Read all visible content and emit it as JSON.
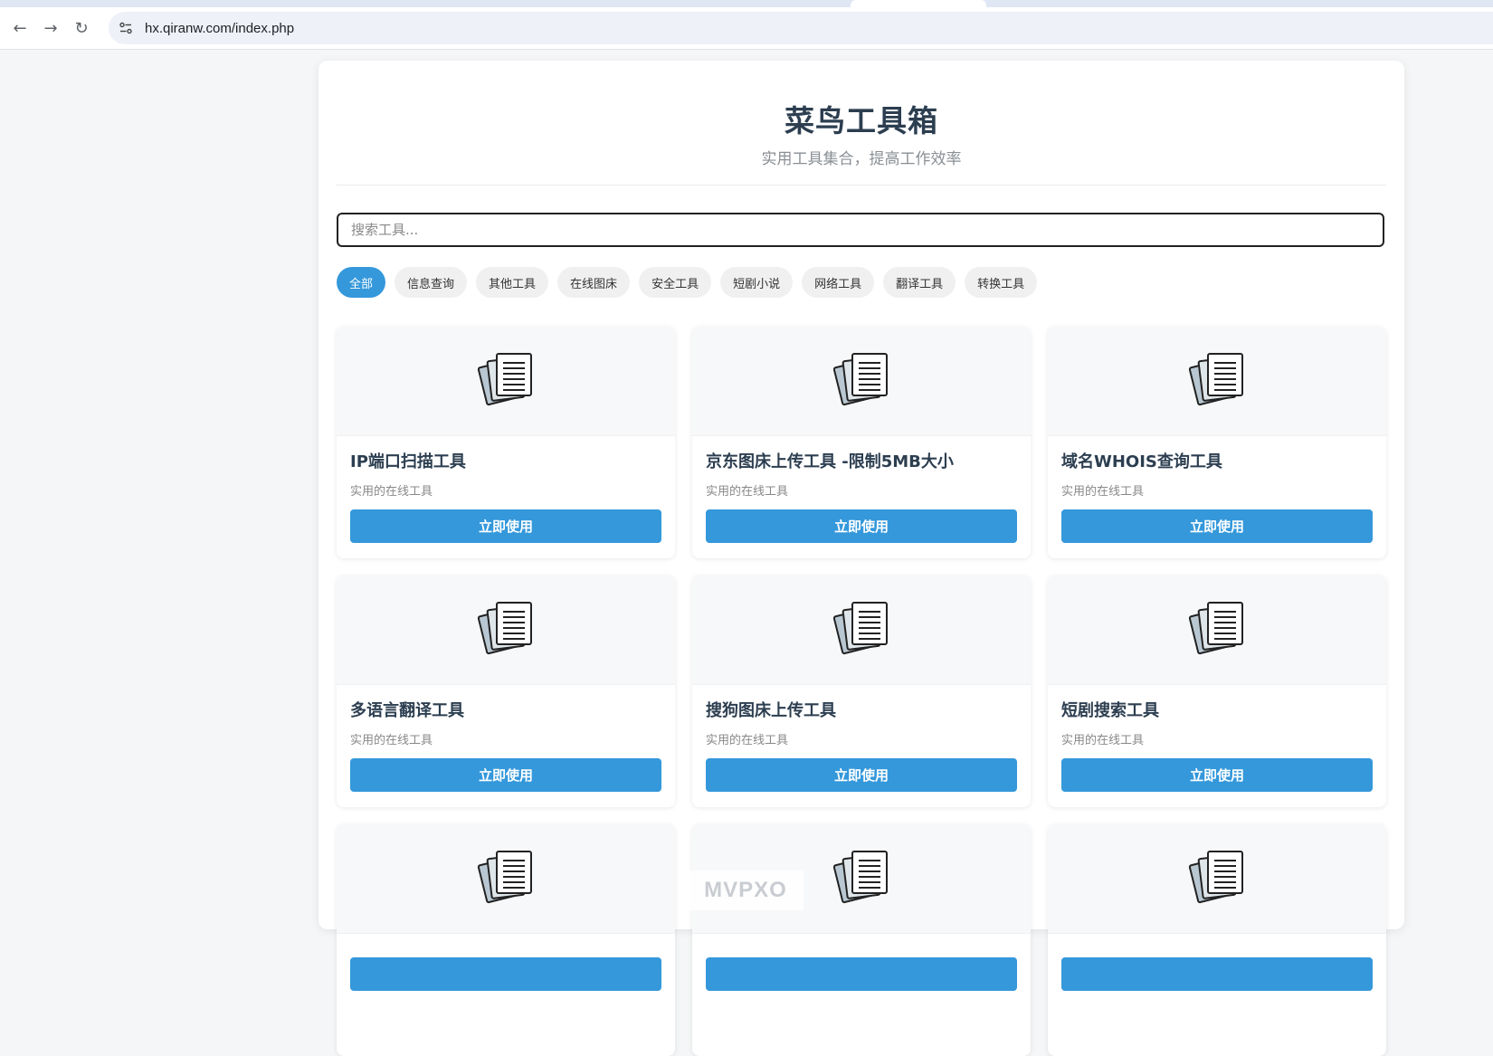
{
  "browser": {
    "url": "hx.qiranw.com/index.php",
    "icons": {
      "back": "arrow-left-icon",
      "forward": "arrow-right-icon",
      "reload": "reload-icon",
      "site_info": "site-settings-icon"
    }
  },
  "header": {
    "title": "菜鸟工具箱",
    "subtitle": "实用工具集合，提高工作效率"
  },
  "search": {
    "placeholder": "搜索工具..."
  },
  "filters": [
    {
      "label": "全部",
      "active": true
    },
    {
      "label": "信息查询",
      "active": false
    },
    {
      "label": "其他工具",
      "active": false
    },
    {
      "label": "在线图床",
      "active": false
    },
    {
      "label": "安全工具",
      "active": false
    },
    {
      "label": "短剧小说",
      "active": false
    },
    {
      "label": "网络工具",
      "active": false
    },
    {
      "label": "翻译工具",
      "active": false
    },
    {
      "label": "转换工具",
      "active": false
    }
  ],
  "tools": [
    {
      "title": "IP端口扫描工具",
      "desc": "实用的在线工具",
      "button": "立即使用",
      "icon": "documents-icon"
    },
    {
      "title": "京东图床上传工具 -限制5MB大小",
      "desc": "实用的在线工具",
      "button": "立即使用",
      "icon": "documents-icon"
    },
    {
      "title": "域名WHOIS查询工具",
      "desc": "实用的在线工具",
      "button": "立即使用",
      "icon": "documents-icon"
    },
    {
      "title": "多语言翻译工具",
      "desc": "实用的在线工具",
      "button": "立即使用",
      "icon": "documents-icon"
    },
    {
      "title": "搜狗图床上传工具",
      "desc": "实用的在线工具",
      "button": "立即使用",
      "icon": "documents-icon"
    },
    {
      "title": "短剧搜索工具",
      "desc": "实用的在线工具",
      "button": "立即使用",
      "icon": "documents-icon"
    },
    {
      "title": "",
      "desc": "",
      "button": "",
      "icon": "documents-icon"
    },
    {
      "title": "",
      "desc": "",
      "button": "",
      "icon": "documents-icon"
    },
    {
      "title": "",
      "desc": "",
      "button": "",
      "icon": "documents-icon"
    }
  ],
  "watermark": "MVPXO",
  "colors": {
    "accent": "#3498db",
    "title": "#2c3e50",
    "page_bg": "#f5f6f7"
  }
}
